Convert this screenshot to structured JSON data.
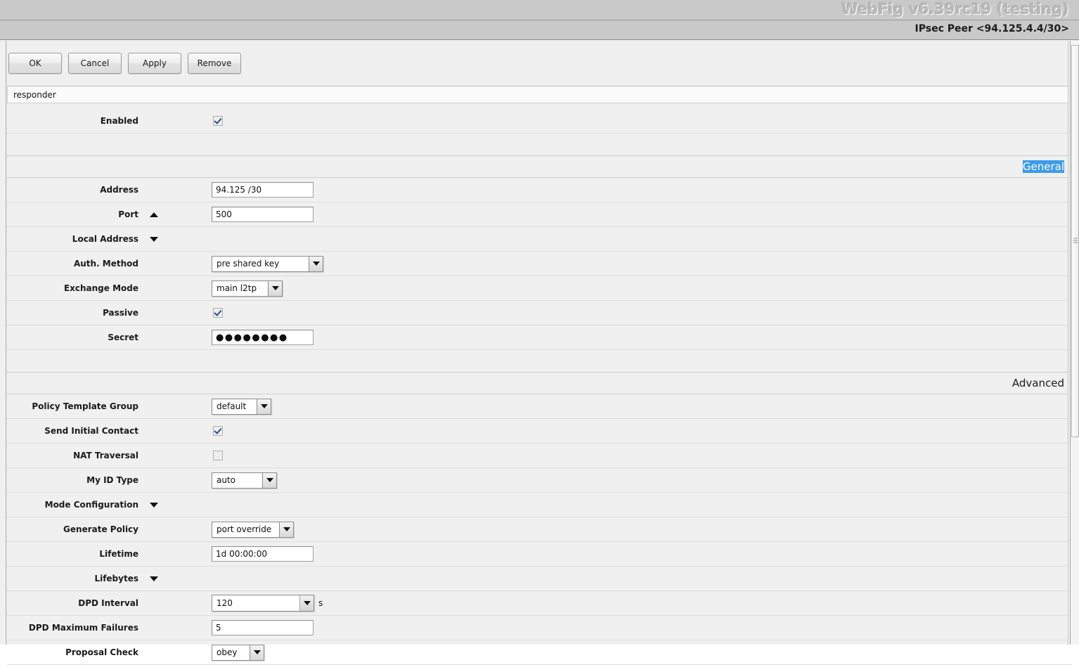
{
  "window": {
    "brand": "WebFig v6.39rc19 (testing)",
    "subtitle": "IPsec Peer <94.125.4.4/30>"
  },
  "toolbar": {
    "ok_label": "OK",
    "cancel_label": "Cancel",
    "apply_label": "Apply",
    "remove_label": "Remove"
  },
  "statusbar": {
    "text": "responder"
  },
  "enabled": {
    "label": "Enabled",
    "checked": true
  },
  "sections": {
    "general": "General",
    "advanced": "Advanced"
  },
  "general": {
    "address": {
      "label": "Address",
      "value": "94.125    /30"
    },
    "port": {
      "label": "Port",
      "value": "500",
      "toggle_icon": "triangle-up"
    },
    "local_address": {
      "label": "Local Address",
      "value": "",
      "toggle_icon": "triangle-down"
    },
    "auth_method": {
      "label": "Auth. Method",
      "value": "pre shared key"
    },
    "exchange_mode": {
      "label": "Exchange Mode",
      "value": "main l2tp"
    },
    "passive": {
      "label": "Passive",
      "checked": true
    },
    "secret": {
      "label": "Secret",
      "value": "●●●●●●●●"
    }
  },
  "advanced": {
    "policy_template_group": {
      "label": "Policy Template Group",
      "value": "default"
    },
    "send_initial_contact": {
      "label": "Send Initial Contact",
      "checked": true
    },
    "nat_traversal": {
      "label": "NAT Traversal",
      "checked": false
    },
    "my_id_type": {
      "label": "My ID Type",
      "value": "auto"
    },
    "mode_configuration": {
      "label": "Mode Configuration",
      "value": "",
      "toggle_icon": "triangle-down"
    },
    "generate_policy": {
      "label": "Generate Policy",
      "value": "port override"
    },
    "lifetime": {
      "label": "Lifetime",
      "value": "1d 00:00:00"
    },
    "lifebytes": {
      "label": "Lifebytes",
      "value": "",
      "toggle_icon": "triangle-down"
    },
    "dpd_interval": {
      "label": "DPD Interval",
      "value": "120",
      "unit": "s"
    },
    "dpd_maximum_failures": {
      "label": "DPD Maximum Failures",
      "value": "5"
    },
    "proposal_check": {
      "label": "Proposal Check",
      "value": "obey"
    }
  },
  "colors": {
    "titlebar_bg": "#c9c9c9",
    "page_bg": "#f0f0f0",
    "selection_blue": "#3d9ae8",
    "checkmark": "#2a4d8f"
  }
}
